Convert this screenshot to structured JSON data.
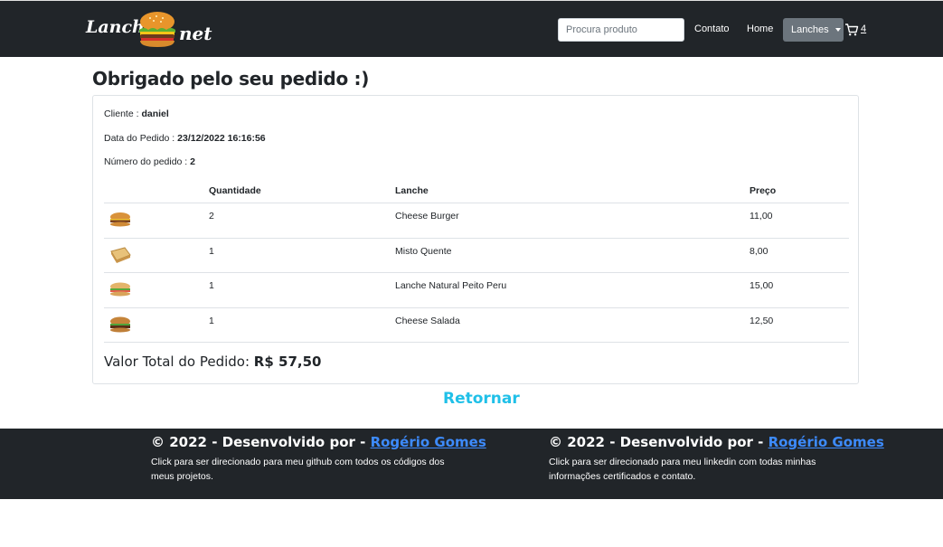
{
  "brand": {
    "left": "Lancho",
    "right": "net"
  },
  "nav": {
    "search_placeholder": "Procura produto",
    "contato": "Contato",
    "home": "Home",
    "lanches": "Lanches",
    "cart_count": "4"
  },
  "main": {
    "title": "Obrigado pelo seu pedido :)",
    "cliente_label": "Cliente : ",
    "cliente_value": "daniel",
    "data_label": "Data do Pedido : ",
    "data_value": "23/12/2022 16:16:56",
    "numero_label": "Número do pedido : ",
    "numero_value": "2",
    "table": {
      "headers": [
        "",
        "Quantidade",
        "Lanche",
        "Preço"
      ],
      "rows": [
        {
          "qty": "2",
          "name": "Cheese Burger",
          "price": "11,00",
          "icon": "cheese-burger-image"
        },
        {
          "qty": "1",
          "name": "Misto Quente",
          "price": "8,00",
          "icon": "misto-quente-image"
        },
        {
          "qty": "1",
          "name": "Lanche Natural Peito Peru",
          "price": "15,00",
          "icon": "lanche-natural-image"
        },
        {
          "qty": "1",
          "name": "Cheese Salada",
          "price": "12,50",
          "icon": "cheese-salada-image"
        }
      ]
    },
    "total_label": "Valor Total do Pedido: ",
    "total_value": "R$ 57,50",
    "retornar": "Retornar"
  },
  "footer": {
    "left": {
      "prefix": "© 2022 - Desenvolvido por - ",
      "link": "Rogério Gomes",
      "desc": "Click para ser direcionado para meu github com todos os códigos dos meus projetos."
    },
    "right": {
      "prefix": "© 2022 - Desenvolvido por - ",
      "link": "Rogério Gomes",
      "desc": "Click para ser direcionado para meu linkedin com todas minhas informações certificados e contato."
    }
  },
  "colors": {
    "navbar": "#212529",
    "accent_link": "#20c0e8",
    "footer_link": "#3d8bfd",
    "dropdown_bg": "#6c757d"
  }
}
